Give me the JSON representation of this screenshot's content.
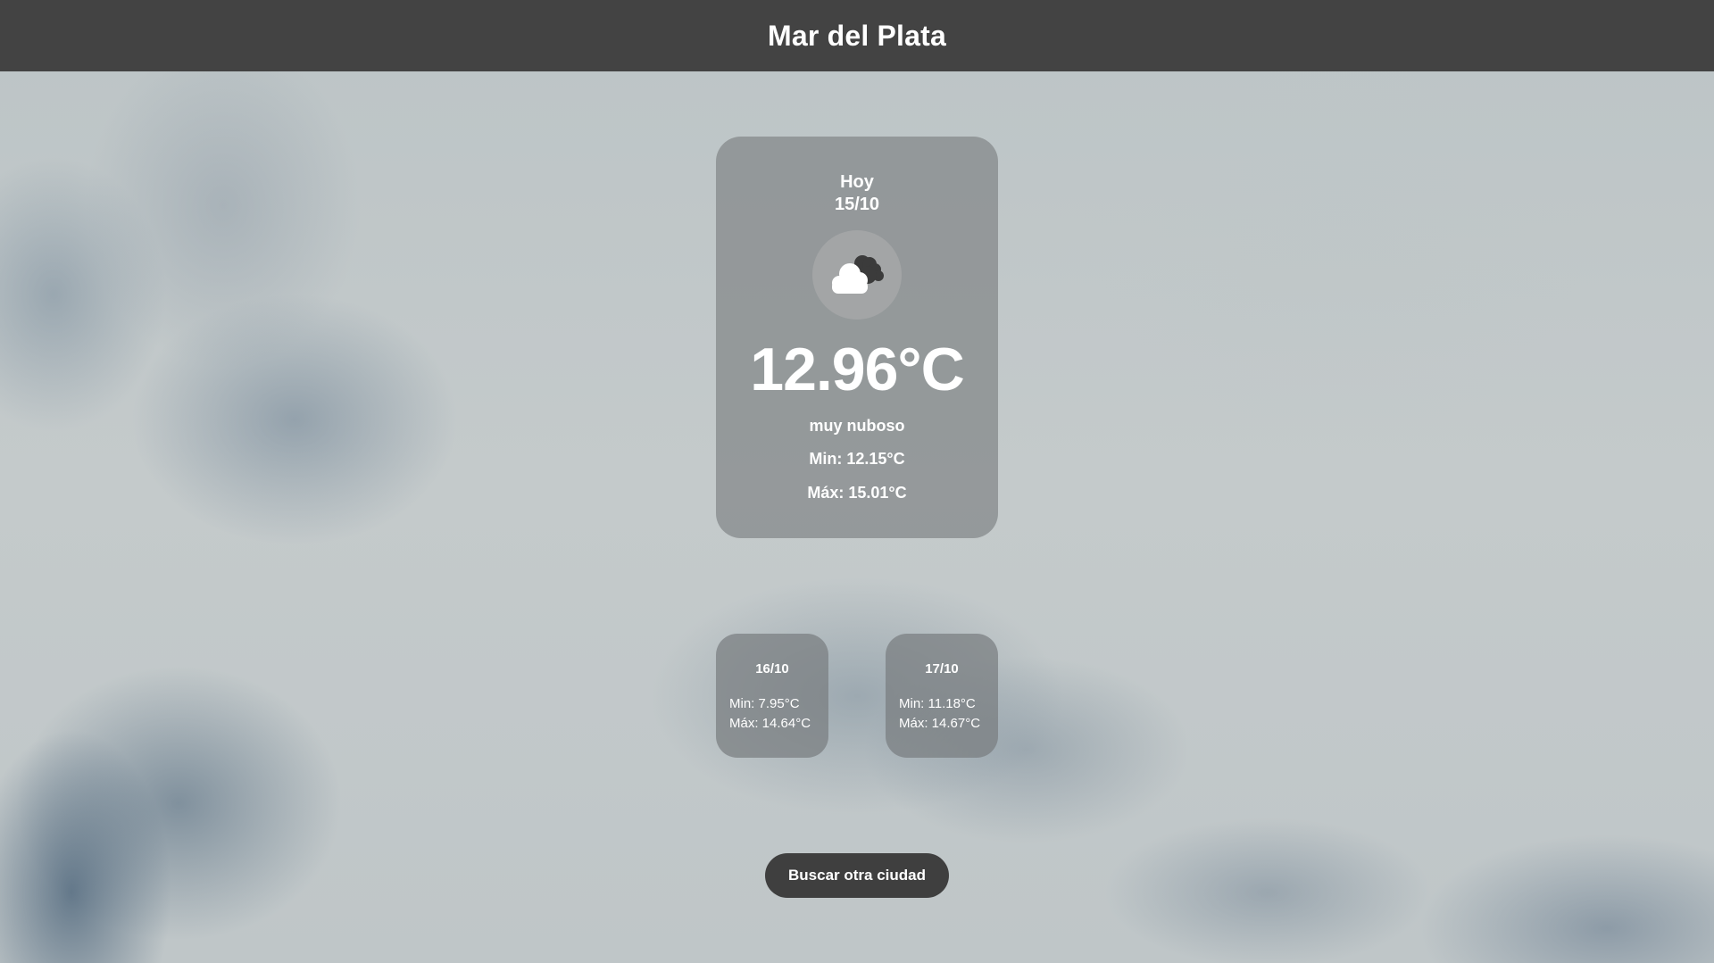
{
  "header": {
    "city": "Mar del Plata"
  },
  "today": {
    "day_label": "Hoy",
    "date": "15/10",
    "icon": "cloud-icon",
    "temperature": "12.96°C",
    "description": "muy nuboso",
    "min": "Min: 12.15°C",
    "max": "Máx: 15.01°C"
  },
  "forecast": [
    {
      "date": "16/10",
      "min": "Min: 7.95°C",
      "max": "Máx: 14.64°C"
    },
    {
      "date": "17/10",
      "min": "Min: 11.18°C",
      "max": "Máx: 14.67°C"
    }
  ],
  "search_button": {
    "label": "Buscar otra ciudad"
  },
  "colors": {
    "header_bg": "#434343",
    "button_bg": "#3f3f3f",
    "text": "#ffffff"
  }
}
